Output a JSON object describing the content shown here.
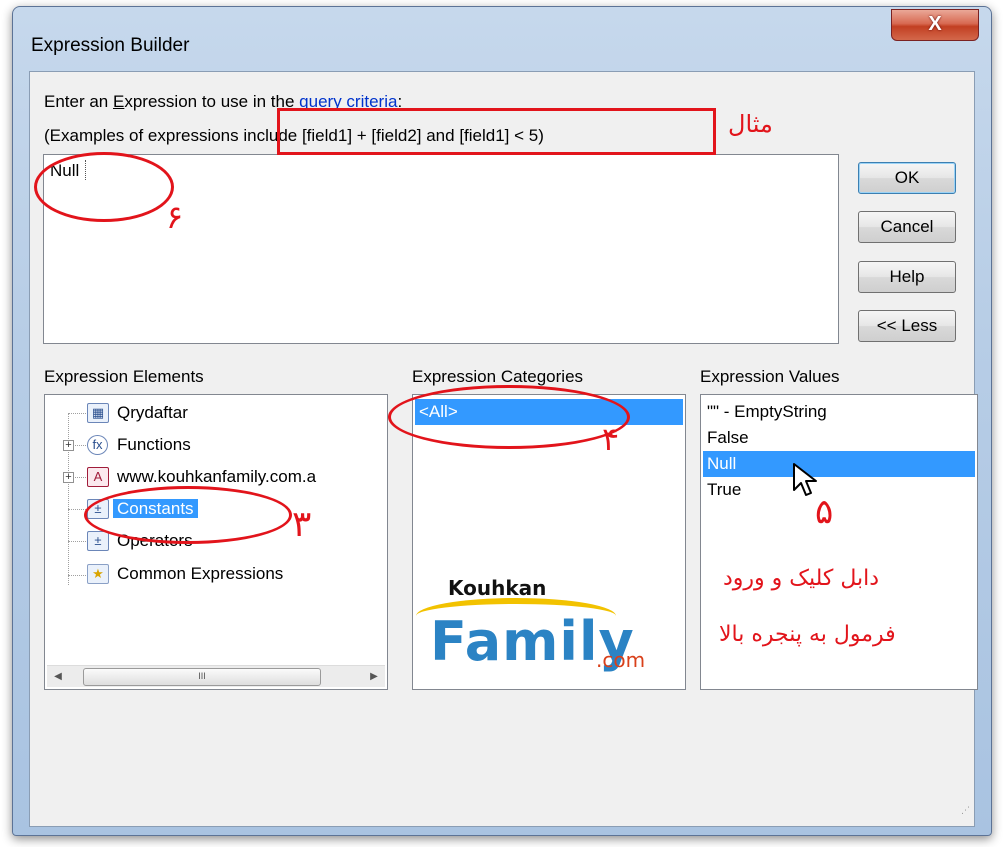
{
  "window": {
    "title": "Expression Builder",
    "close_label": "X"
  },
  "prompt": {
    "before": "Enter an ",
    "mnemonic": "E",
    "middle": "xpression to use in the ",
    "link": "query criteria",
    "after": ":"
  },
  "examples_text": "(Examples of expressions include [field1] + [field2] and [field1] < 5)",
  "expression_value": "Null",
  "buttons": {
    "ok": "OK",
    "cancel": "Cancel",
    "help": "Help",
    "less": "<< Less"
  },
  "elements_panel": {
    "label": "Expression Elements",
    "items": [
      {
        "label": "Qrydaftar",
        "icon": "query-icon",
        "expandable": false,
        "selected": false
      },
      {
        "label": "Functions",
        "icon": "function-icon",
        "expandable": true,
        "selected": false
      },
      {
        "label": "www.kouhkanfamily.com.a",
        "icon": "access-db-icon",
        "expandable": true,
        "selected": false
      },
      {
        "label": "Constants",
        "icon": "constants-icon",
        "expandable": false,
        "selected": true
      },
      {
        "label": "Operators",
        "icon": "operators-icon",
        "expandable": false,
        "selected": false
      },
      {
        "label": "Common Expressions",
        "icon": "common-expressions-icon",
        "expandable": false,
        "selected": false
      }
    ],
    "scroll_grip": "III"
  },
  "categories_panel": {
    "label": "Expression Categories",
    "items": [
      {
        "label": "<All>",
        "selected": true
      }
    ]
  },
  "values_panel": {
    "label": "Expression Values",
    "items": [
      {
        "label": "\"\" - EmptyString",
        "selected": false
      },
      {
        "label": "False",
        "selected": false
      },
      {
        "label": "Null",
        "selected": true
      },
      {
        "label": "True",
        "selected": false
      }
    ]
  },
  "annotations": {
    "example": "مثال",
    "num_expression": "۶",
    "num_category": "۴",
    "num_element": "۳",
    "num_value": "۵",
    "instruction_line1": "دابل کلیک و ورود",
    "instruction_line2": "فرمول به پنجره بالا"
  },
  "logo": {
    "top": "Kouhkan",
    "main": "Family",
    "sub": ".com"
  },
  "colors": {
    "selection": "#3399ff",
    "annotation_red": "#e2141b",
    "link_blue": "#0033cc"
  }
}
